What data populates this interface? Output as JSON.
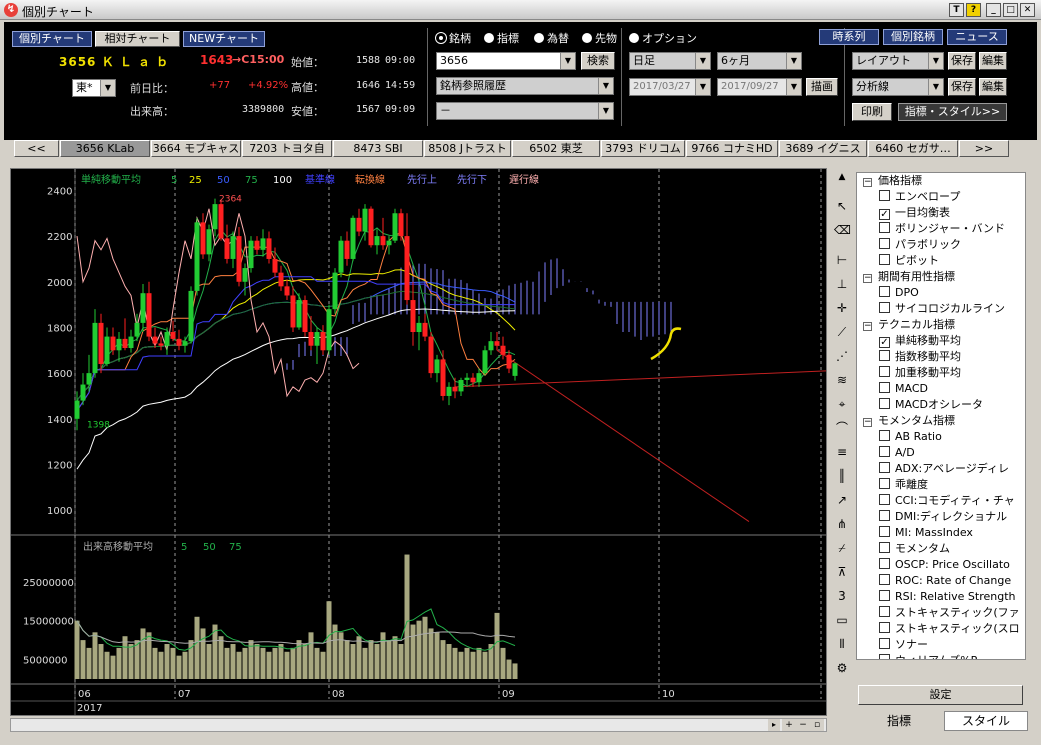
{
  "window": {
    "title": "個別チャート",
    "icon_glyph": "↯",
    "buttons": [
      "T",
      "?",
      "_",
      "□",
      "✕"
    ]
  },
  "nav_buttons": [
    "個別チャート",
    "相対チャート",
    "NEWチャート"
  ],
  "stock": {
    "code_name": "3656 Ｋ Ｌ ａ ｂ",
    "price": "1643",
    "price_time": "→C15:00",
    "market": "東*",
    "change_label": "前日比：",
    "change": "+77",
    "change_pct": "+4.92%",
    "volume_label": "出来高：",
    "volume": "3389800",
    "open_label": "始値：",
    "open": "1588",
    "open_time": "09:00",
    "high_label": "高値：",
    "high": "1646",
    "high_time": "14:59",
    "low_label": "安値：",
    "low": "1567",
    "low_time": "09:09"
  },
  "radio": {
    "options": [
      "銘柄",
      "指標",
      "為替",
      "先物",
      "オプション"
    ],
    "selected": 0
  },
  "search": {
    "code": "3656",
    "button": "検索",
    "history": "銘柄参照履歴",
    "third": "－"
  },
  "period": {
    "type": "日足",
    "range": "6ヶ月",
    "from": "2017/03/27",
    "to": "2017/09/27",
    "draw": "描画"
  },
  "right_tabs": [
    "時系列",
    "個別銘柄",
    "ニュース"
  ],
  "layout": {
    "label": "レイアウト",
    "save": "保存",
    "edit": "編集"
  },
  "analysis": {
    "label": "分析線",
    "save": "保存",
    "edit": "編集"
  },
  "print": "印刷",
  "indicator_style": "指標・スタイル>>",
  "stock_tabs": [
    "<<",
    "3656 KLab",
    "3664 モブキャス",
    "7203 トヨタ自",
    "8473 SBI",
    "8508 Jトラスト",
    "6502 東芝",
    "3793 ドリコム",
    "9766 コナミHD",
    "3689 イグニス",
    "6460 セガサ…",
    ">>"
  ],
  "stock_tab_active": 1,
  "legend": {
    "sma": "単純移動平均",
    "sma_5": "5",
    "sma_25": "25",
    "sma_50": "50",
    "sma_75": "75",
    "sma_100": "100",
    "kijun": "基準線",
    "tenkan": "転換線",
    "senko_a": "先行上",
    "senko_b": "先行下",
    "chikou": "遅行線",
    "vol_ma": "出来高移動平均",
    "vol_5": "5",
    "vol_50": "50",
    "vol_75": "75"
  },
  "annotations": {
    "high": "2364",
    "low": "1398"
  },
  "axis": {
    "price_ticks": [
      "2400",
      "2200",
      "2000",
      "1800",
      "1600",
      "1400",
      "1200",
      "1000"
    ],
    "volume_ticks": [
      "25000000",
      "15000000",
      "5000000"
    ],
    "months": [
      "06",
      "07",
      "08",
      "09",
      "10"
    ],
    "year": "2017"
  },
  "colors": {
    "sma5": "#22b04a",
    "sma25": "#f0f000",
    "sma50": "#3a5cff",
    "sma75": "#1f6f2f",
    "sma100": "#ffffff",
    "kijun": "#4040ff",
    "tenkan": "#ff8040",
    "senko": "#8080ff",
    "chikou": "#ffb0b0",
    "up": "#22cc33",
    "down": "#ff2020",
    "volume": "#a8a880"
  },
  "chart_data": [
    {
      "type": "candlestick",
      "ylim": [
        900,
        2450
      ],
      "x": [
        "06",
        "07",
        "08",
        "09",
        "10"
      ],
      "ohlc": [
        [
          1400,
          1520,
          1350,
          1480
        ],
        [
          1480,
          1600,
          1460,
          1550
        ],
        [
          1550,
          1680,
          1520,
          1600
        ],
        [
          1600,
          1880,
          1580,
          1820
        ],
        [
          1820,
          1860,
          1600,
          1640
        ],
        [
          1640,
          1800,
          1630,
          1760
        ],
        [
          1760,
          1800,
          1680,
          1700
        ],
        [
          1700,
          1780,
          1650,
          1750
        ],
        [
          1750,
          1840,
          1700,
          1710
        ],
        [
          1710,
          1790,
          1690,
          1760
        ],
        [
          1760,
          1860,
          1740,
          1820
        ],
        [
          1820,
          1990,
          1780,
          1950
        ],
        [
          1950,
          2000,
          1740,
          1760
        ],
        [
          1760,
          1800,
          1710,
          1730
        ],
        [
          1730,
          1760,
          1700,
          1720
        ],
        [
          1720,
          1800,
          1680,
          1780
        ],
        [
          1780,
          1830,
          1740,
          1750
        ],
        [
          1750,
          1790,
          1700,
          1720
        ],
        [
          1720,
          1760,
          1690,
          1740
        ],
        [
          1740,
          1980,
          1730,
          1960
        ],
        [
          1960,
          2280,
          1940,
          2260
        ],
        [
          2260,
          2300,
          2100,
          2120
        ],
        [
          2120,
          2250,
          2090,
          2230
        ],
        [
          2230,
          2364,
          2200,
          2340
        ],
        [
          2340,
          2360,
          2180,
          2190
        ],
        [
          2190,
          2250,
          2080,
          2100
        ],
        [
          2100,
          2220,
          2060,
          2200
        ],
        [
          2200,
          2240,
          1980,
          2000
        ],
        [
          2000,
          2080,
          1940,
          2060
        ],
        [
          2060,
          2200,
          2040,
          2180
        ],
        [
          2180,
          2200,
          2120,
          2140
        ],
        [
          2140,
          2230,
          2110,
          2190
        ],
        [
          2190,
          2220,
          2080,
          2100
        ],
        [
          2100,
          2150,
          2020,
          2040
        ],
        [
          2040,
          2070,
          1960,
          1980
        ],
        [
          1980,
          2010,
          1920,
          1940
        ],
        [
          1940,
          1980,
          1780,
          1800
        ],
        [
          1800,
          1950,
          1790,
          1920
        ],
        [
          1920,
          1940,
          1760,
          1780
        ],
        [
          1780,
          1850,
          1700,
          1720
        ],
        [
          1720,
          1800,
          1640,
          1780
        ],
        [
          1780,
          1810,
          1680,
          1700
        ],
        [
          1700,
          1900,
          1680,
          1880
        ],
        [
          1880,
          2060,
          1860,
          2040
        ],
        [
          2040,
          2200,
          2020,
          2180
        ],
        [
          2180,
          2220,
          2070,
          2100
        ],
        [
          2100,
          2290,
          2090,
          2280
        ],
        [
          2280,
          2320,
          2200,
          2220
        ],
        [
          2220,
          2340,
          2180,
          2320
        ],
        [
          2320,
          2330,
          2150,
          2160
        ],
        [
          2160,
          2230,
          2120,
          2200
        ],
        [
          2200,
          2280,
          2140,
          2160
        ],
        [
          2160,
          2200,
          2120,
          2180
        ],
        [
          2180,
          2320,
          2170,
          2300
        ],
        [
          2300,
          2320,
          2180,
          2200
        ],
        [
          2200,
          2300,
          1900,
          1920
        ],
        [
          1920,
          2000,
          1720,
          1780
        ],
        [
          1780,
          1850,
          1700,
          1820
        ],
        [
          1820,
          1860,
          1740,
          1760
        ],
        [
          1760,
          1780,
          1580,
          1600
        ],
        [
          1600,
          1680,
          1560,
          1660
        ],
        [
          1660,
          1700,
          1480,
          1500
        ],
        [
          1500,
          1560,
          1460,
          1540
        ],
        [
          1540,
          1580,
          1490,
          1520
        ],
        [
          1520,
          1580,
          1500,
          1570
        ],
        [
          1570,
          1600,
          1540,
          1580
        ],
        [
          1580,
          1600,
          1540,
          1560
        ],
        [
          1560,
          1620,
          1540,
          1600
        ],
        [
          1600,
          1720,
          1590,
          1700
        ],
        [
          1700,
          1780,
          1680,
          1740
        ],
        [
          1740,
          1780,
          1700,
          1720
        ],
        [
          1720,
          1760,
          1660,
          1680
        ],
        [
          1680,
          1700,
          1600,
          1620
        ],
        [
          1588,
          1646,
          1567,
          1643
        ]
      ]
    },
    {
      "type": "bar",
      "title": "出来高",
      "ylim": [
        0,
        36000000
      ],
      "values": [
        15000000,
        10000000,
        8000000,
        12000000,
        9000000,
        7000000,
        6000000,
        8000000,
        11000000,
        9000000,
        10000000,
        13000000,
        12000000,
        8000000,
        7000000,
        9000000,
        8000000,
        6000000,
        7000000,
        10000000,
        16000000,
        13000000,
        9000000,
        14000000,
        11000000,
        8000000,
        9000000,
        7000000,
        8000000,
        10000000,
        9000000,
        8000000,
        7000000,
        8000000,
        9000000,
        7000000,
        8000000,
        10000000,
        9000000,
        12000000,
        8000000,
        7000000,
        20000000,
        14000000,
        12000000,
        10000000,
        9000000,
        11000000,
        8000000,
        10000000,
        9000000,
        12000000,
        10000000,
        11000000,
        9000000,
        32000000,
        14000000,
        15000000,
        16000000,
        13000000,
        12000000,
        10000000,
        9000000,
        8000000,
        7000000,
        8000000,
        7000000,
        8000000,
        7000000,
        9000000,
        17000000,
        8000000,
        5000000,
        4000000
      ]
    }
  ],
  "panel": {
    "groups": [
      {
        "label": "価格指標",
        "items": [
          {
            "label": "エンベロープ",
            "checked": false
          },
          {
            "label": "一目均衡表",
            "checked": true
          },
          {
            "label": "ボリンジャー・バンド",
            "checked": false
          },
          {
            "label": "パラボリック",
            "checked": false
          },
          {
            "label": "ピボット",
            "checked": false
          }
        ]
      },
      {
        "label": "期間有用性指標",
        "items": [
          {
            "label": "DPO",
            "checked": false
          },
          {
            "label": "サイコロジカルライン",
            "checked": false
          }
        ]
      },
      {
        "label": "テクニカル指標",
        "items": [
          {
            "label": "単純移動平均",
            "checked": true
          },
          {
            "label": "指数移動平均",
            "checked": false
          },
          {
            "label": "加重移動平均",
            "checked": false
          },
          {
            "label": "MACD",
            "checked": false
          },
          {
            "label": "MACDオシレータ",
            "checked": false
          }
        ]
      },
      {
        "label": "モメンタム指標",
        "items": [
          {
            "label": "AB Ratio",
            "checked": false
          },
          {
            "label": "A/D",
            "checked": false
          },
          {
            "label": "ADX:アベレージディレ",
            "checked": false
          },
          {
            "label": "乖離度",
            "checked": false
          },
          {
            "label": "CCI:コモディティ・チャ",
            "checked": false
          },
          {
            "label": "DMI:ディレクショナル",
            "checked": false
          },
          {
            "label": "MI: MassIndex",
            "checked": false
          },
          {
            "label": "モメンタム",
            "checked": false
          },
          {
            "label": "OSCP: Price Oscillato",
            "checked": false
          },
          {
            "label": "ROC: Rate of Change",
            "checked": false
          },
          {
            "label": "RSI: Relative Strength",
            "checked": false
          },
          {
            "label": "ストキャスティック(ファ",
            "checked": false
          },
          {
            "label": "ストキャスティック(スロ",
            "checked": false
          },
          {
            "label": "ソナー",
            "checked": false
          },
          {
            "label": "ウィリアムズ%R",
            "checked": false
          }
        ]
      }
    ],
    "settings": "設定",
    "tabs": [
      "指標",
      "スタイル"
    ]
  }
}
